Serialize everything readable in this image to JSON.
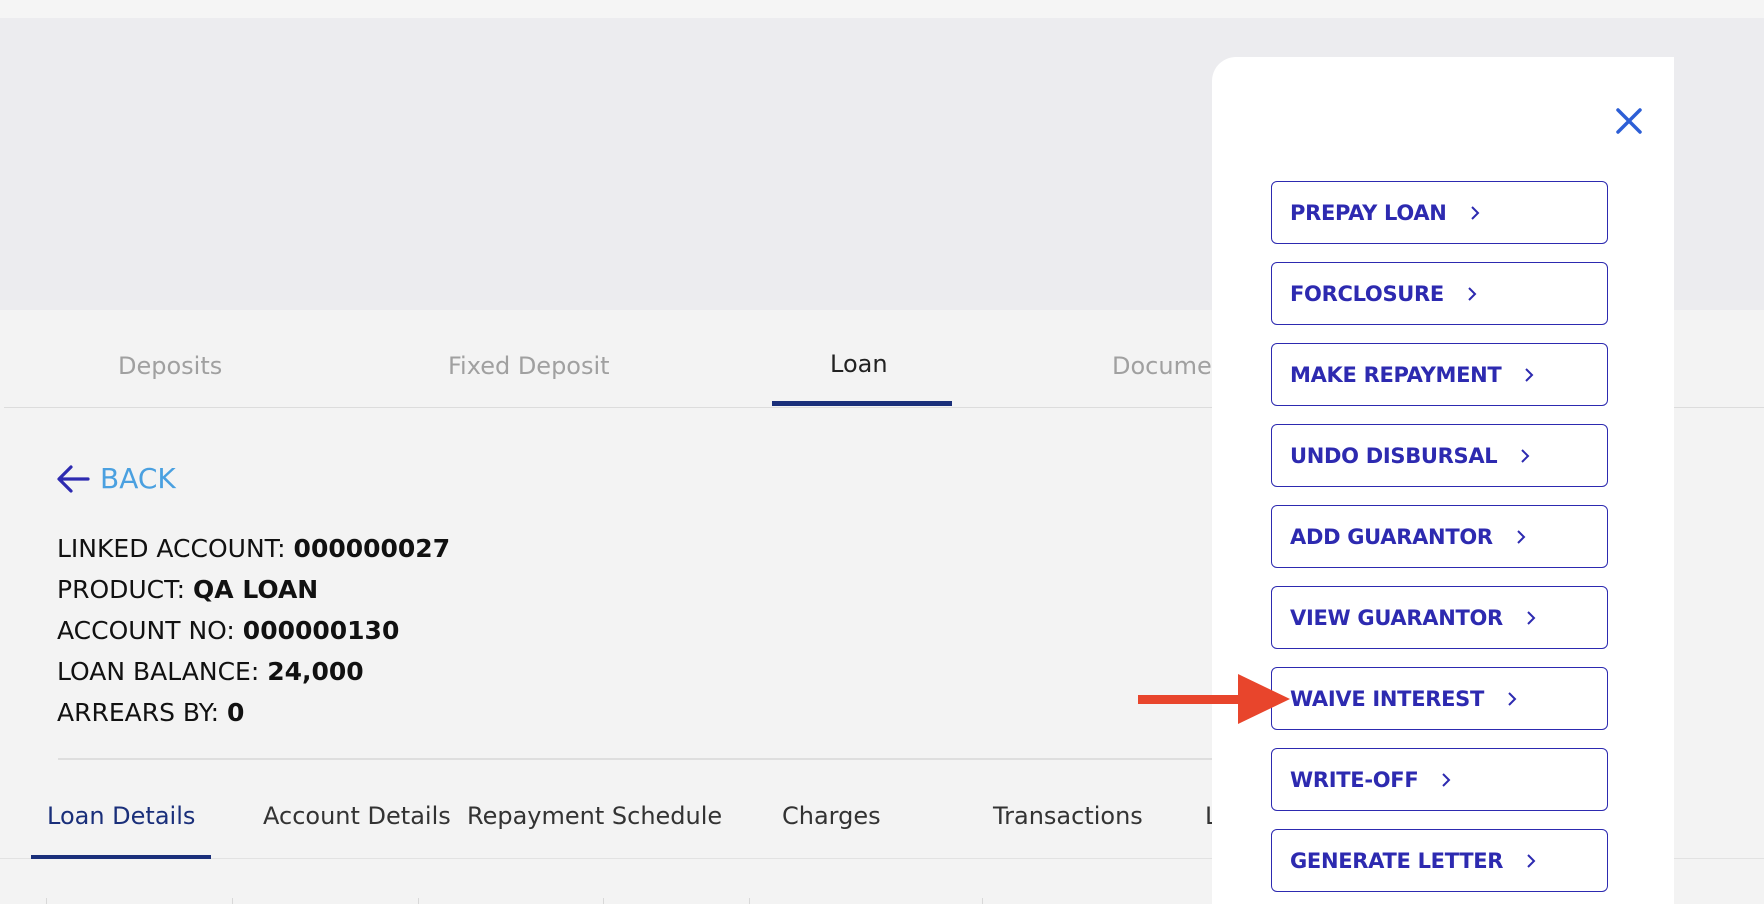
{
  "tabs": [
    "Deposits",
    "Fixed Deposit",
    "Loan",
    "Documen"
  ],
  "active_tab": "Loan",
  "back_label": "BACK",
  "account": {
    "linked_account_label": "LINKED ACCOUNT:",
    "linked_account_value": "000000027",
    "product_label": "PRODUCT:",
    "product_value": "QA LOAN",
    "account_no_label": "ACCOUNT NO:",
    "account_no_value": "000000130",
    "loan_balance_label": "LOAN BALANCE:",
    "loan_balance_value": "24,000",
    "arrears_label": "ARREARS BY:",
    "arrears_value": "0"
  },
  "subtabs": [
    "Loan Details",
    "Account Details",
    "Repayment Schedule",
    "Charges",
    "Transactions",
    "L"
  ],
  "active_subtab": "Loan Details",
  "actions": [
    "PREPAY LOAN",
    "FORCLOSURE",
    "MAKE REPAYMENT",
    "UNDO DISBURSAL",
    "ADD GUARANTOR",
    "VIEW GUARANTOR",
    "WAIVE INTEREST",
    "WRITE-OFF",
    "GENERATE LETTER"
  ],
  "highlighted_action": "WAIVE INTEREST",
  "colors": {
    "accent": "#2d2ab0",
    "tab_active": "#1a2f7a",
    "back_link": "#4aa0e0",
    "annotation_arrow": "#e8452c"
  },
  "icons": {
    "back": "arrow-left-icon",
    "close": "close-icon",
    "action": "chevron-right-icon",
    "annotation": "red-pointer-arrow-icon"
  }
}
